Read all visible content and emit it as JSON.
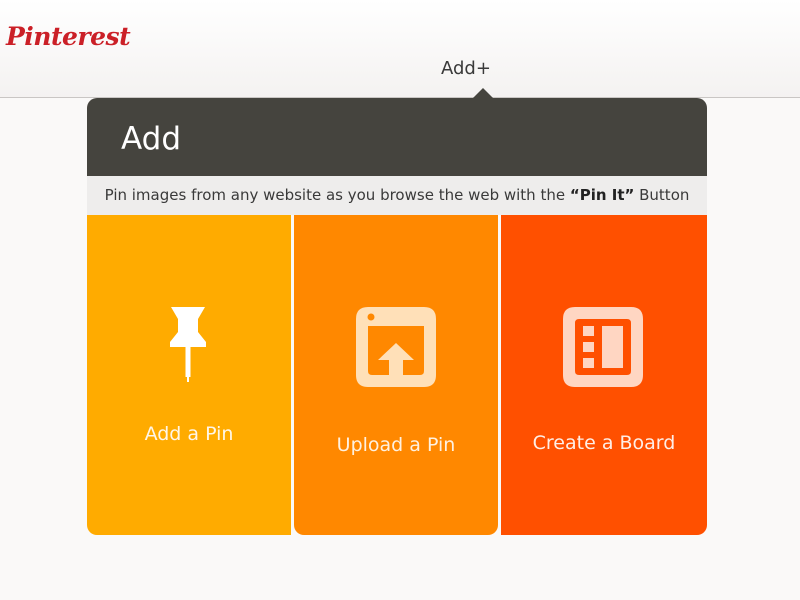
{
  "header": {
    "logo_text": "Pinterest",
    "add_nav_label": "Add+"
  },
  "modal": {
    "title": "Add",
    "info": {
      "prefix": "Pin images from any website as you browse the web with the ",
      "highlight": "“Pin It”",
      "suffix": " Button"
    },
    "tiles": [
      {
        "label": "Add a Pin",
        "icon": "pushpin-icon",
        "color": "#ffab00"
      },
      {
        "label": "Upload a Pin",
        "icon": "upload-icon",
        "color": "#ff8800"
      },
      {
        "label": "Create a Board",
        "icon": "board-icon",
        "color": "#ff5000"
      }
    ]
  },
  "colors": {
    "brand": "#cb2027",
    "header_dark": "#45443e"
  }
}
